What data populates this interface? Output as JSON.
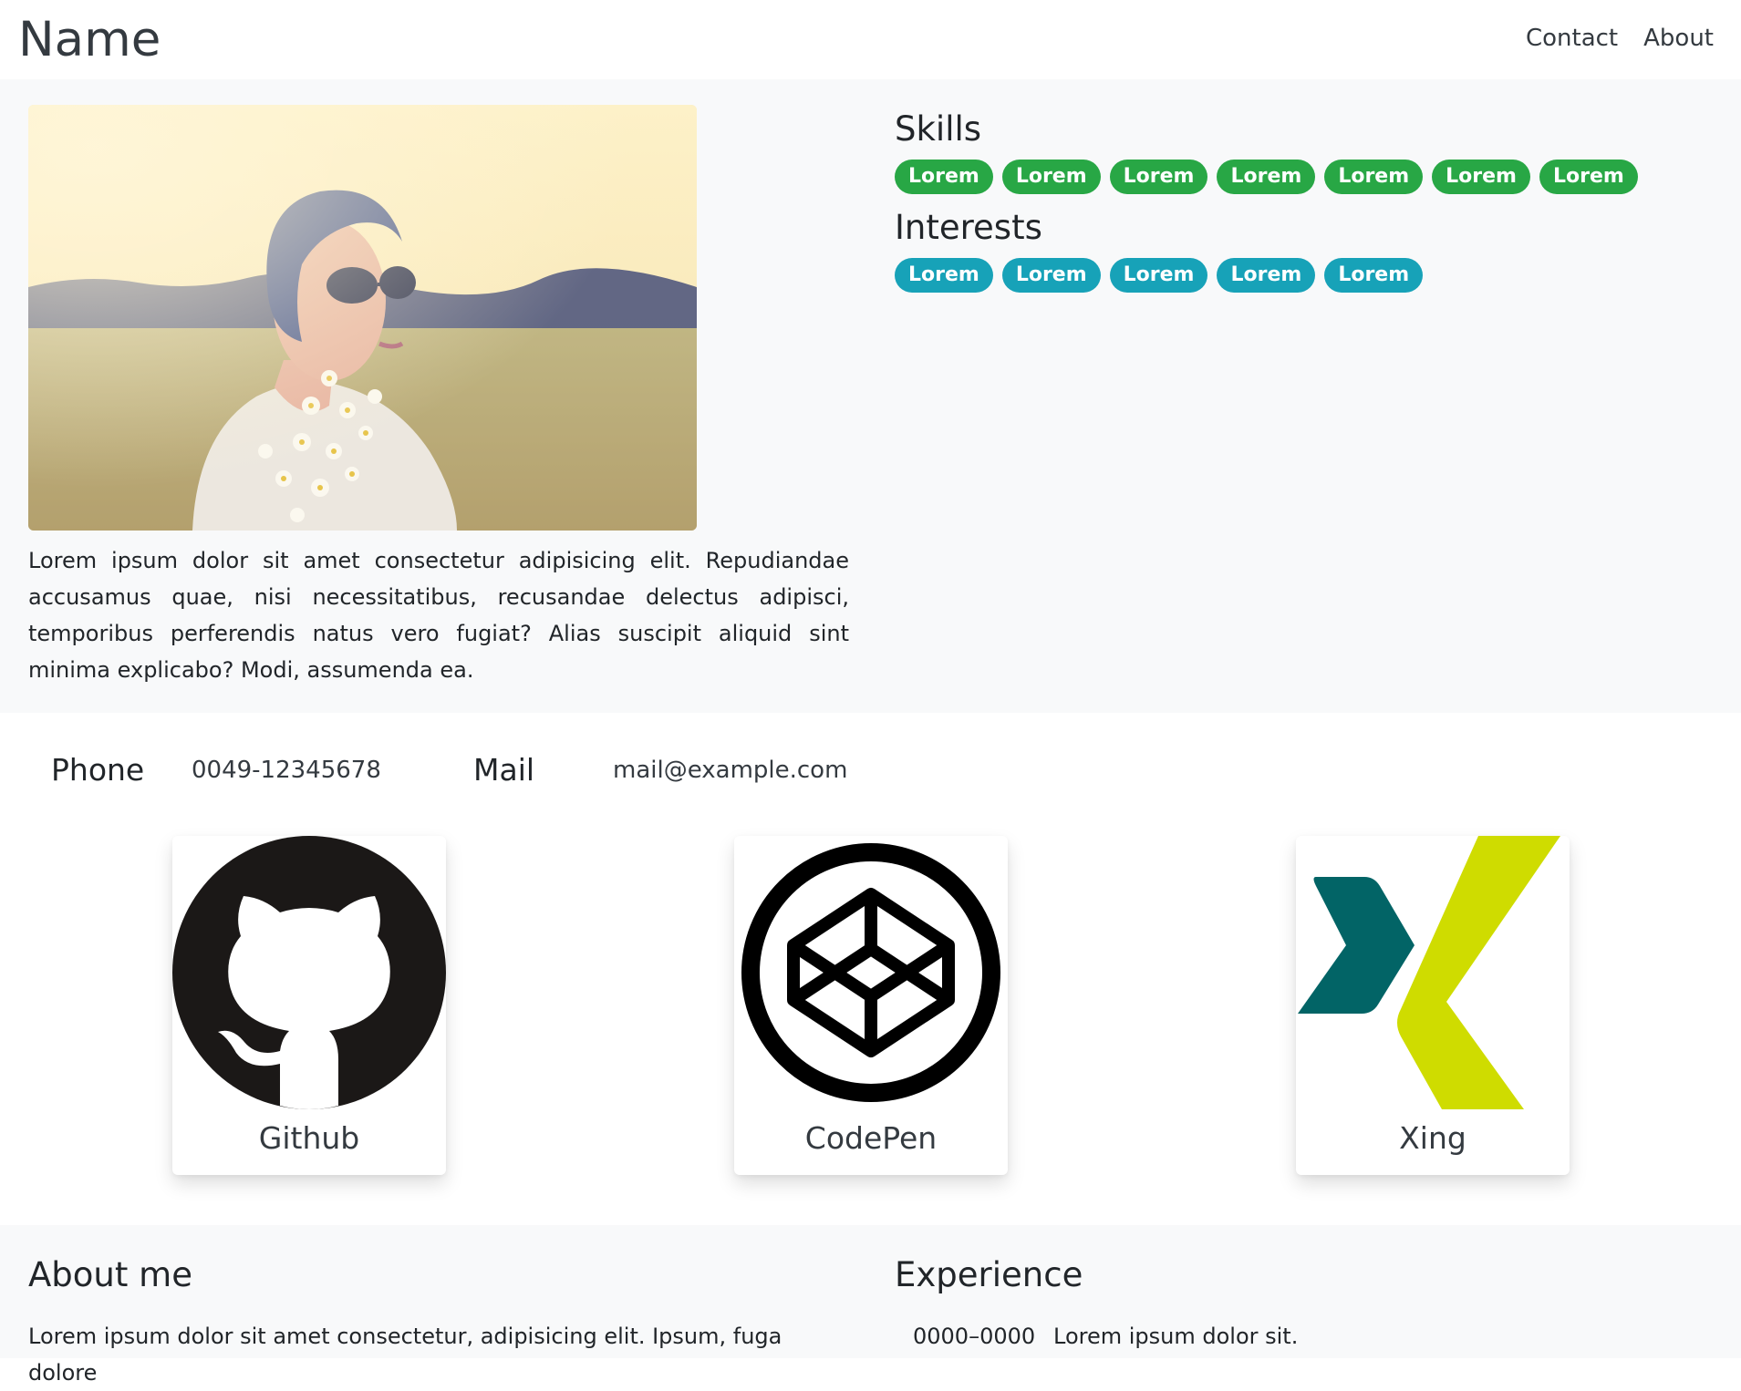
{
  "navbar": {
    "brand": "Name",
    "links": [
      "Contact",
      "About"
    ]
  },
  "profile": {
    "bio": "Lorem ipsum dolor sit amet consectetur adipisicing elit. Repudiandae accusamus quae, nisi necessitatibus, recusandae delectus adipisci, temporibus perferendis natus vero fugiat? Alias suscipit aliquid sint minima explicabo? Modi, assumenda ea.",
    "skills_heading": "Skills",
    "skills": [
      "Lorem",
      "Lorem",
      "Lorem",
      "Lorem",
      "Lorem",
      "Lorem",
      "Lorem"
    ],
    "interests_heading": "Interests",
    "interests": [
      "Lorem",
      "Lorem",
      "Lorem",
      "Lorem",
      "Lorem"
    ]
  },
  "contact": {
    "phone_label": "Phone",
    "phone_value": "0049-12345678",
    "mail_label": "Mail",
    "mail_value": "mail@example.com"
  },
  "social": {
    "cards": [
      {
        "title": "Github",
        "icon": "github-icon"
      },
      {
        "title": "CodePen",
        "icon": "codepen-icon"
      },
      {
        "title": "Xing",
        "icon": "xing-icon"
      }
    ]
  },
  "about": {
    "heading": "About me",
    "text": "Lorem ipsum dolor sit amet consectetur, adipisicing elit. Ipsum, fuga dolore"
  },
  "experience": {
    "heading": "Experience",
    "items": [
      {
        "years": "0000–0000",
        "text": "Lorem ipsum dolor sit."
      }
    ]
  },
  "colors": {
    "skill_badge": "#28a745",
    "interest_badge": "#17a2b8",
    "band_background": "#f8f9fa",
    "xing_teal": "#026466",
    "xing_lime": "#cfdc00"
  }
}
